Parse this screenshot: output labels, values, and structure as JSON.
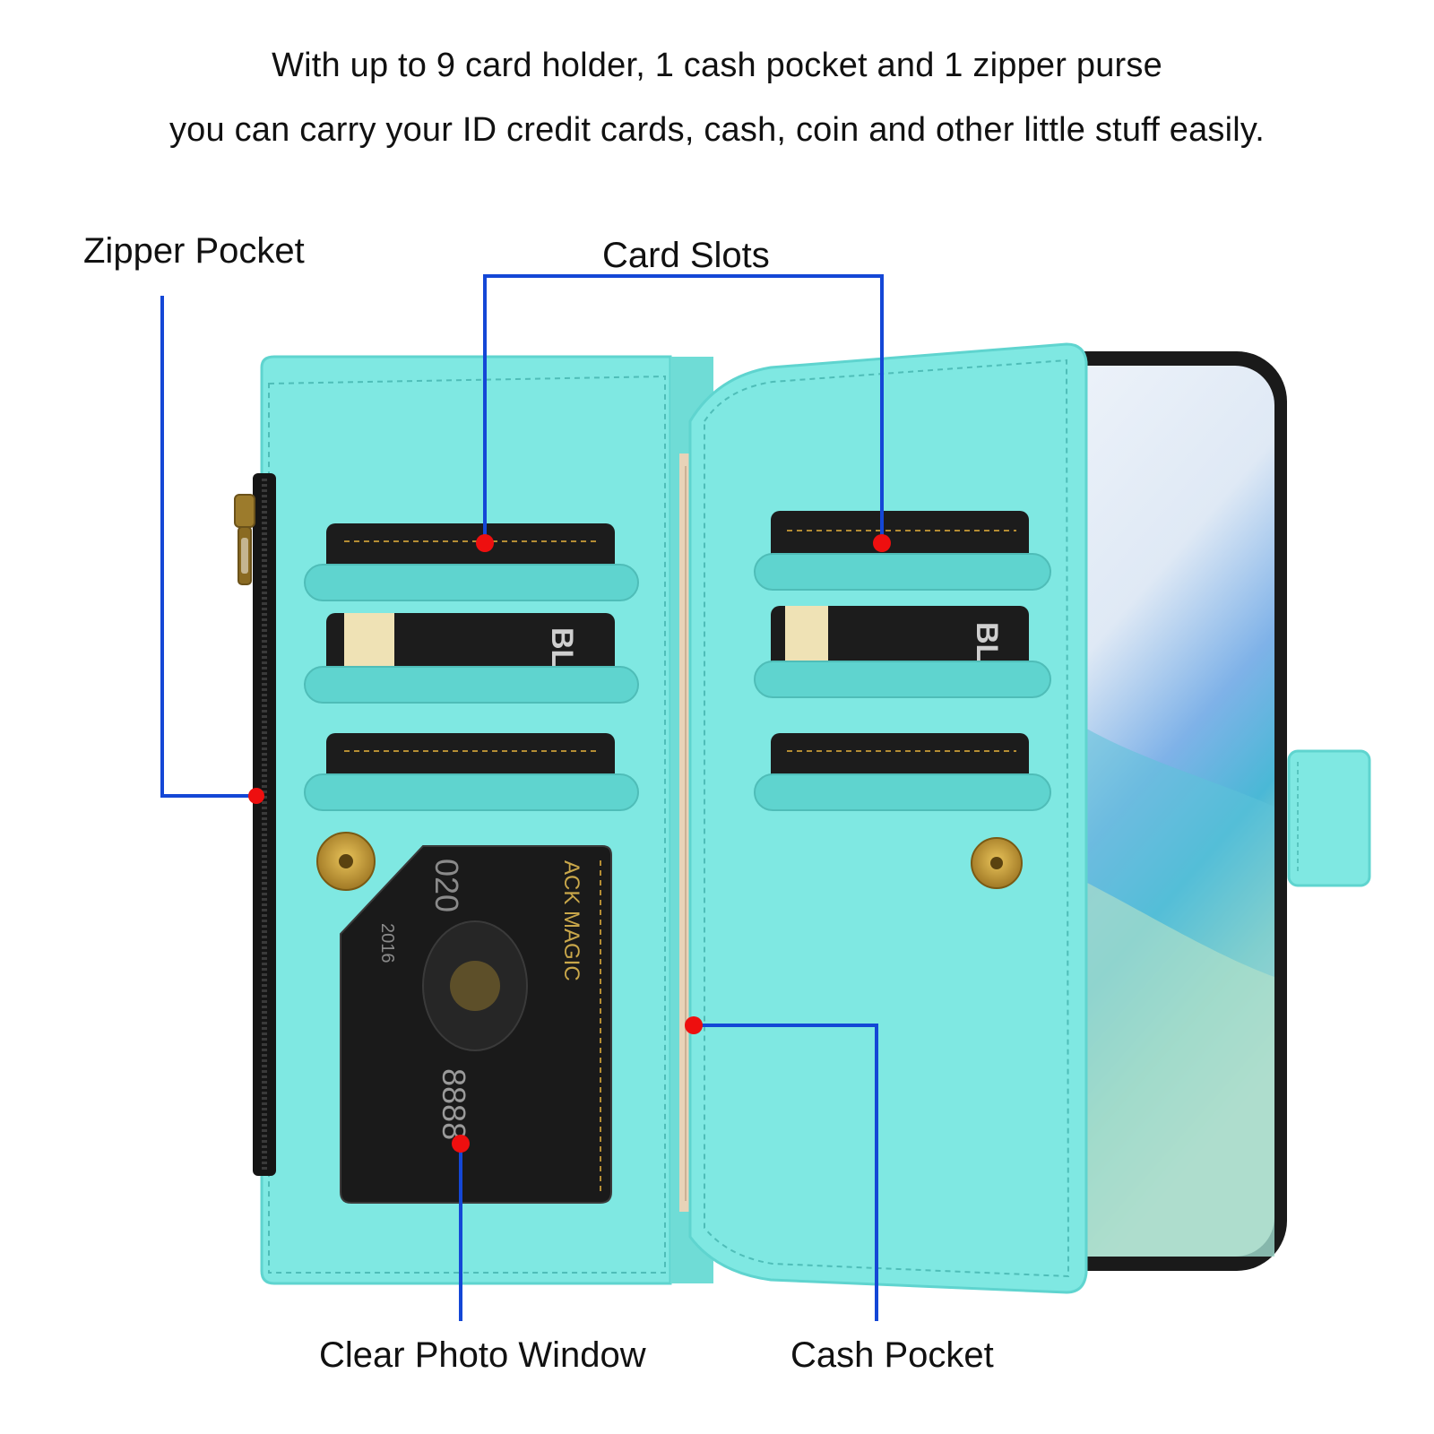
{
  "headline": {
    "line1": "With up to 9 card holder, 1 cash pocket and 1 zipper purse",
    "line2": "you can carry your ID credit cards, cash, coin and other little stuff easily."
  },
  "callouts": {
    "zipper_pocket": "Zipper Pocket",
    "card_slots": "Card Slots",
    "clear_photo_window": "Clear Photo Window",
    "cash_pocket": "Cash Pocket"
  },
  "card_text": {
    "brand_short": "BL",
    "magic_text": "ACK MAGIC",
    "year": "2016",
    "number_top": "020",
    "number_bottom": "8888"
  },
  "colors": {
    "leather": "#7fe8e2",
    "leather_dark": "#5fd4cf",
    "callout_line": "#1447d6",
    "callout_dot": "#ee0f0f",
    "card": "#1c1c1c",
    "brass": "#b8902a"
  }
}
